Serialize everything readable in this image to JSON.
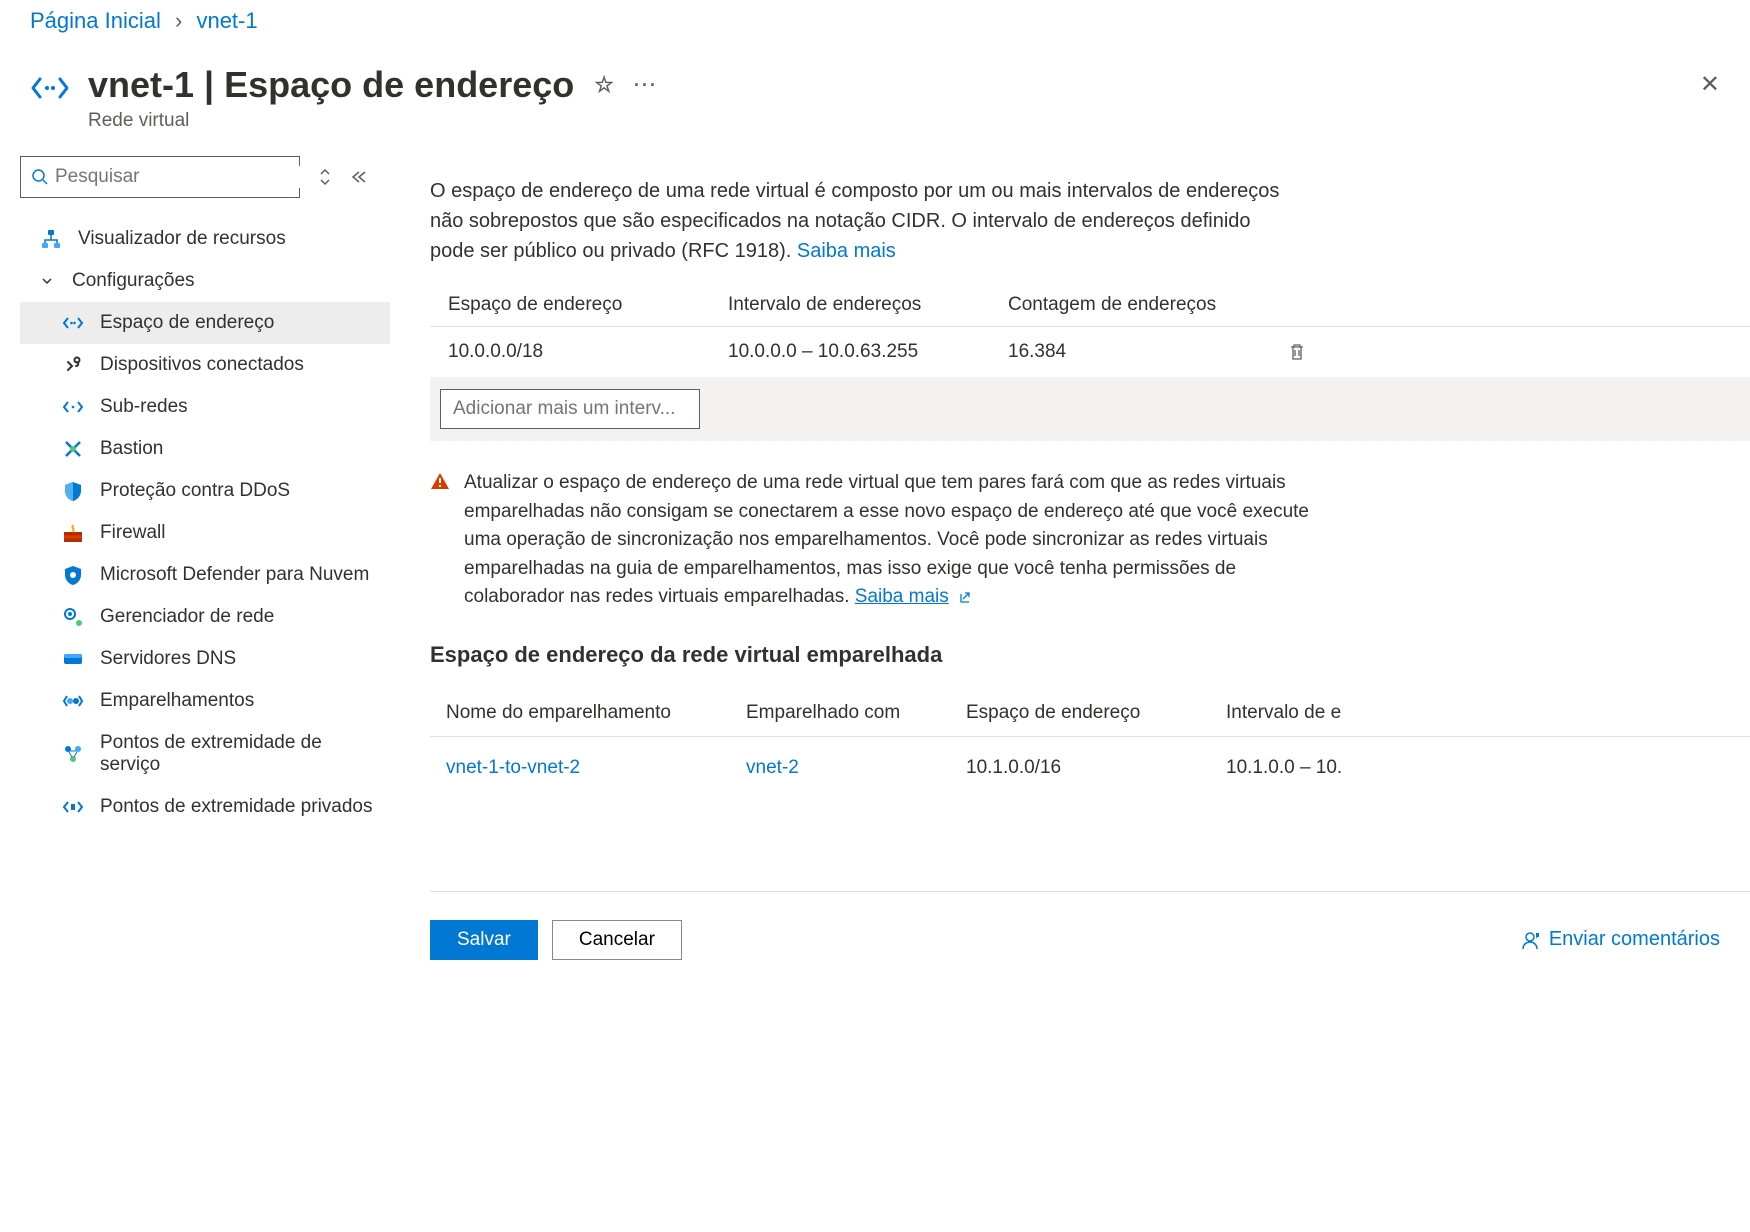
{
  "breadcrumb": {
    "home": "Página Inicial",
    "current": "vnet-1"
  },
  "header": {
    "title": "vnet-1 | Espaço de endereço",
    "subtitle": "Rede virtual"
  },
  "sidebar": {
    "search_placeholder": "Pesquisar",
    "resource_visualizer": "Visualizador de recursos",
    "settings_group": "Configurações",
    "items": {
      "address_space": "Espaço de endereço",
      "connected": "Dispositivos conectados",
      "subnets": "Sub-redes",
      "bastion": "Bastion",
      "ddos": "Proteção contra DDoS",
      "firewall": "Firewall",
      "defender": "Microsoft Defender para Nuvem",
      "netmgr": "Gerenciador de rede",
      "dns": "Servidores DNS",
      "peerings": "Emparelhamentos",
      "svc_endpoints": "Pontos de extremidade de serviço",
      "priv_endpoints": "Pontos de extremidade privados"
    }
  },
  "main": {
    "intro_text": "O espaço de endereço de uma rede virtual é composto por um ou mais intervalos de endereços não sobrepostos que são especificados na notação CIDR. O intervalo de endereços definido pode ser público ou privado (RFC 1918). ",
    "intro_link": "Saiba mais",
    "table_headers": {
      "address_space": "Espaço de endereço",
      "range": "Intervalo de endereços",
      "count": "Contagem de endereços"
    },
    "rows": [
      {
        "address_space": "10.0.0.0/18",
        "range": "10.0.0.0 – 10.0.63.255",
        "count": "16.384"
      }
    ],
    "add_range_placeholder": "Adicionar mais um interv...",
    "warning_text": "Atualizar o espaço de endereço de uma rede virtual que tem pares fará com que as redes virtuais emparelhadas não consigam se conectarem a esse novo espaço de endereço até que você execute uma operação de sincronização nos emparelhamentos. Você pode sincronizar as redes virtuais emparelhadas na guia de emparelhamentos, mas isso exige que você tenha permissões de colaborador nas redes virtuais emparelhadas. ",
    "warning_link": "Saiba mais",
    "peered_section_title": "Espaço de endereço da rede virtual emparelhada",
    "peered_headers": {
      "name": "Nome do emparelhamento",
      "with": "Emparelhado com",
      "space": "Espaço de endereço",
      "range": "Intervalo de e"
    },
    "peered_rows": [
      {
        "name": "vnet-1-to-vnet-2",
        "with": "vnet-2",
        "space": "10.1.0.0/16",
        "range": "10.1.0.0 – 10."
      }
    ],
    "save_button": "Salvar",
    "cancel_button": "Cancelar",
    "feedback": "Enviar comentários"
  }
}
